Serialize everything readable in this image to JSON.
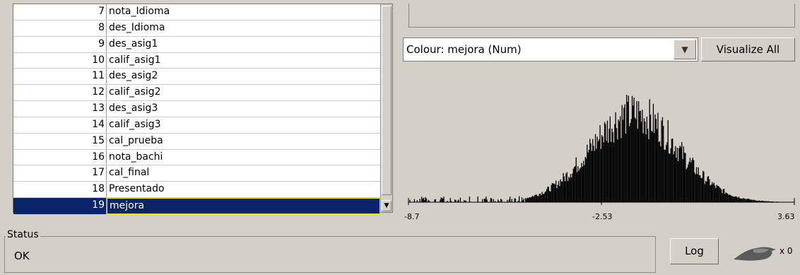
{
  "attributes": [
    {
      "num": "7",
      "name": "nota_Idioma"
    },
    {
      "num": "8",
      "name": "des_Idioma"
    },
    {
      "num": "9",
      "name": "des_asig1"
    },
    {
      "num": "10",
      "name": "calif_asig1"
    },
    {
      "num": "11",
      "name": "des_asig2"
    },
    {
      "num": "12",
      "name": "calif_asig2"
    },
    {
      "num": "13",
      "name": "des_asig3"
    },
    {
      "num": "14",
      "name": "calif_asig3"
    },
    {
      "num": "15",
      "name": "cal_prueba"
    },
    {
      "num": "16",
      "name": "nota_bachi"
    },
    {
      "num": "17",
      "name": "cal_final"
    },
    {
      "num": "18",
      "name": "Presentado"
    },
    {
      "num": "19",
      "name": "mejora"
    }
  ],
  "selected_index": 12,
  "colour_select": {
    "label": "Colour: mejora (Num)"
  },
  "visualize_button": {
    "label": "Visualize All"
  },
  "chart_data": {
    "type": "bar",
    "x_ticks": [
      "-8.7",
      "-2.53",
      "3.63"
    ],
    "xlim": [
      -8.7,
      3.63
    ],
    "color": "#000000"
  },
  "status": {
    "title": "Status",
    "text": "OK"
  },
  "log_button": {
    "label": "Log"
  },
  "task_count": "x 0",
  "colors": {
    "selection": "#0a246a",
    "background": "#d4d0c8"
  }
}
